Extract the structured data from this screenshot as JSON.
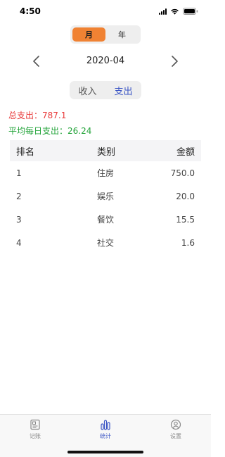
{
  "status_bar": {
    "time": "4:50"
  },
  "period_toggle": {
    "options": [
      "月",
      "年"
    ],
    "selected": "月"
  },
  "date_nav": {
    "current": "2020-04"
  },
  "type_toggle": {
    "options": [
      "收入",
      "支出"
    ],
    "selected": "支出"
  },
  "summary": {
    "total": "总支出：787.1",
    "average": "平均每日支出：26.24"
  },
  "table": {
    "headers": {
      "rank": "排名",
      "category": "类别",
      "amount": "金额"
    },
    "rows": [
      {
        "rank": "1",
        "category": "住房",
        "amount": "750.0"
      },
      {
        "rank": "2",
        "category": "娱乐",
        "amount": "20.0"
      },
      {
        "rank": "3",
        "category": "餐饮",
        "amount": "15.5"
      },
      {
        "rank": "4",
        "category": "社交",
        "amount": "1.6"
      }
    ]
  },
  "tab_bar": {
    "items": [
      {
        "label": "记账",
        "icon": "ledger-icon"
      },
      {
        "label": "统计",
        "icon": "bar-chart-icon"
      },
      {
        "label": "设置",
        "icon": "user-circle-icon"
      }
    ],
    "active": "统计"
  },
  "colors": {
    "accent_orange": "#f08233",
    "accent_blue": "#3b55c5",
    "total_red": "#e83a3a",
    "average_green": "#21a338"
  }
}
